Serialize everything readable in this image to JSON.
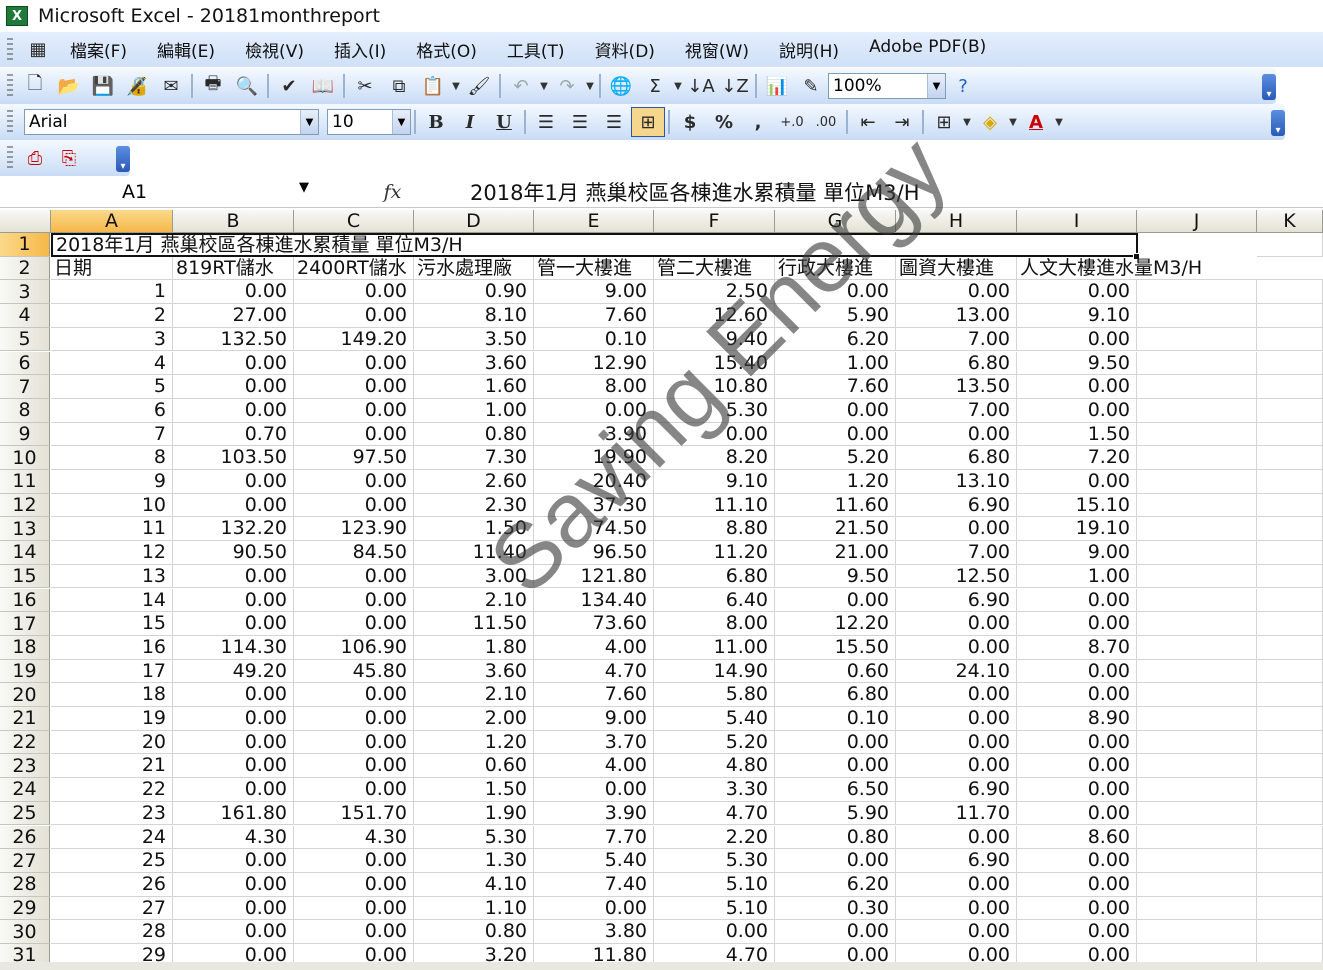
{
  "app": {
    "title": "Microsoft Excel - 20181monthreport",
    "icon": "excel-icon"
  },
  "menu": [
    "檔案(F)",
    "編輯(E)",
    "檢視(V)",
    "插入(I)",
    "格式(O)",
    "工具(T)",
    "資料(D)",
    "視窗(W)",
    "說明(H)",
    "Adobe PDF(B)"
  ],
  "toolbar": {
    "zoom": "100%",
    "font": "Arial",
    "size": "10",
    "sum_glyph": "Σ",
    "bold": "B",
    "italic": "I",
    "underline": "U",
    "currency": "$",
    "percent": "%",
    "comma": ","
  },
  "formula_bar": {
    "cell_ref": "A1",
    "fx": "fx",
    "content": "2018年1月 燕巢校區各棟進水累積量  單位M3/H"
  },
  "columns": [
    "A",
    "B",
    "C",
    "D",
    "E",
    "F",
    "G",
    "H",
    "I",
    "J",
    "K"
  ],
  "sheet": {
    "title_row": "2018年1月 燕巢校區各棟進水累積量  單位M3/H",
    "headers": [
      "日期",
      "819RT儲水",
      "2400RT儲水",
      "污水處理廠",
      "管一大樓進",
      "管二大樓進",
      "行政大樓進",
      "圖資大樓進",
      "人文大樓進水量M3/H"
    ],
    "rows": [
      [
        "1",
        "0.00",
        "0.00",
        "0.90",
        "9.00",
        "2.50",
        "0.00",
        "0.00",
        "0.00"
      ],
      [
        "2",
        "27.00",
        "0.00",
        "8.10",
        "7.60",
        "12.60",
        "5.90",
        "13.00",
        "9.10"
      ],
      [
        "3",
        "132.50",
        "149.20",
        "3.50",
        "0.10",
        "9.40",
        "6.20",
        "7.00",
        "0.00"
      ],
      [
        "4",
        "0.00",
        "0.00",
        "3.60",
        "12.90",
        "15.40",
        "1.00",
        "6.80",
        "9.50"
      ],
      [
        "5",
        "0.00",
        "0.00",
        "1.60",
        "8.00",
        "10.80",
        "7.60",
        "13.50",
        "0.00"
      ],
      [
        "6",
        "0.00",
        "0.00",
        "1.00",
        "0.00",
        "5.30",
        "0.00",
        "7.00",
        "0.00"
      ],
      [
        "7",
        "0.70",
        "0.00",
        "0.80",
        "3.90",
        "0.00",
        "0.00",
        "0.00",
        "1.50"
      ],
      [
        "8",
        "103.50",
        "97.50",
        "7.30",
        "19.90",
        "8.20",
        "5.20",
        "6.80",
        "7.20"
      ],
      [
        "9",
        "0.00",
        "0.00",
        "2.60",
        "20.40",
        "9.10",
        "1.20",
        "13.10",
        "0.00"
      ],
      [
        "10",
        "0.00",
        "0.00",
        "2.30",
        "37.30",
        "11.10",
        "11.60",
        "6.90",
        "15.10"
      ],
      [
        "11",
        "132.20",
        "123.90",
        "1.50",
        "74.50",
        "8.80",
        "21.50",
        "0.00",
        "19.10"
      ],
      [
        "12",
        "90.50",
        "84.50",
        "11.40",
        "96.50",
        "11.20",
        "21.00",
        "7.00",
        "9.00"
      ],
      [
        "13",
        "0.00",
        "0.00",
        "3.00",
        "121.80",
        "6.80",
        "9.50",
        "12.50",
        "1.00"
      ],
      [
        "14",
        "0.00",
        "0.00",
        "2.10",
        "134.40",
        "6.40",
        "0.00",
        "6.90",
        "0.00"
      ],
      [
        "15",
        "0.00",
        "0.00",
        "11.50",
        "73.60",
        "8.00",
        "12.20",
        "0.00",
        "0.00"
      ],
      [
        "16",
        "114.30",
        "106.90",
        "1.80",
        "4.00",
        "11.00",
        "15.50",
        "0.00",
        "8.70"
      ],
      [
        "17",
        "49.20",
        "45.80",
        "3.60",
        "4.70",
        "14.90",
        "0.60",
        "24.10",
        "0.00"
      ],
      [
        "18",
        "0.00",
        "0.00",
        "2.10",
        "7.60",
        "5.80",
        "6.80",
        "0.00",
        "0.00"
      ],
      [
        "19",
        "0.00",
        "0.00",
        "2.00",
        "9.00",
        "5.40",
        "0.10",
        "0.00",
        "8.90"
      ],
      [
        "20",
        "0.00",
        "0.00",
        "1.20",
        "3.70",
        "5.20",
        "0.00",
        "0.00",
        "0.00"
      ],
      [
        "21",
        "0.00",
        "0.00",
        "0.60",
        "4.00",
        "4.80",
        "0.00",
        "0.00",
        "0.00"
      ],
      [
        "22",
        "0.00",
        "0.00",
        "1.50",
        "0.00",
        "3.30",
        "6.50",
        "6.90",
        "0.00"
      ],
      [
        "23",
        "161.80",
        "151.70",
        "1.90",
        "3.90",
        "4.70",
        "5.90",
        "11.70",
        "0.00"
      ],
      [
        "24",
        "4.30",
        "4.30",
        "5.30",
        "7.70",
        "2.20",
        "0.80",
        "0.00",
        "8.60"
      ],
      [
        "25",
        "0.00",
        "0.00",
        "1.30",
        "5.40",
        "5.30",
        "0.00",
        "6.90",
        "0.00"
      ],
      [
        "26",
        "0.00",
        "0.00",
        "4.10",
        "7.40",
        "5.10",
        "6.20",
        "0.00",
        "0.00"
      ],
      [
        "27",
        "0.00",
        "0.00",
        "1.10",
        "0.00",
        "5.10",
        "0.30",
        "0.00",
        "0.00"
      ],
      [
        "28",
        "0.00",
        "0.00",
        "0.80",
        "3.80",
        "0.00",
        "0.00",
        "0.00",
        "0.00"
      ],
      [
        "29",
        "0.00",
        "0.00",
        "3.20",
        "11.80",
        "4.70",
        "0.00",
        "0.00",
        "0.00"
      ]
    ]
  },
  "watermark": "Saving Energy"
}
